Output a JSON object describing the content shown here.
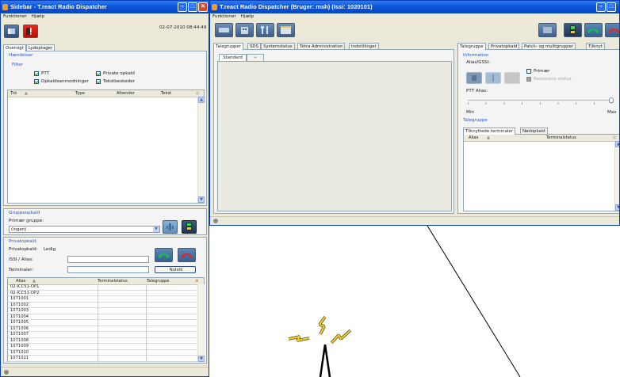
{
  "sidebar": {
    "title": "Sidebar - T.react Radio Dispatcher",
    "menu": [
      "Funktioner",
      "Hjælp"
    ],
    "datetime": "02-07-2010 08:44:49",
    "tabs": [
      "Oversigt",
      "Lydoptager"
    ],
    "events": {
      "section": "Hændelser",
      "filter_label": "Filter",
      "filters": [
        {
          "label": "PTT",
          "checked": true
        },
        {
          "label": "Private opkald",
          "checked": true
        },
        {
          "label": "Opkaldsanmodninger",
          "checked": true
        },
        {
          "label": "Tekstbeskeder",
          "checked": true
        }
      ],
      "columns": [
        "Tid",
        "Type",
        "Afsender",
        "Tekst"
      ]
    },
    "group_call": {
      "section": "Gruppeopkald",
      "primary_label": "Primær gruppe:",
      "primary_value": "(ingen)"
    },
    "private_call": {
      "section": "Privatopkald",
      "status_label": "Privatopkald:",
      "status_value": "Ledig",
      "issi_label": "ISSI / Alias:",
      "terminal_label": "Terminaler:",
      "reset_button": "Nulstil"
    },
    "terminal_table": {
      "columns": [
        "Alias",
        "Terminalstatus",
        "Talegruppe"
      ],
      "rows": [
        "02-ICC51-OP1",
        "02-ICC51-OP2",
        "1071001",
        "1071002",
        "1071003",
        "1071004",
        "1071005",
        "1071006",
        "1071007",
        "1071008",
        "1071009",
        "1071010",
        "1071011"
      ]
    }
  },
  "main": {
    "title": "T.react Radio Dispatcher (Bruger: msh) (Issi: 1020101)",
    "menu": [
      "Funktioner",
      "Hjælp"
    ],
    "tabs": [
      "Talegrupper",
      "SDS",
      "Systemstatus",
      "Tetra Administration",
      "Indstillinger"
    ],
    "subtabs": [
      "Standard",
      "+"
    ],
    "right_tabs": [
      "Talegruppe",
      "Privatopkald",
      "Patch- og multigrupper",
      "Tilknyt"
    ],
    "information": {
      "section": "Information",
      "alias_label": "Alias/GSSI:",
      "primary_label": "Primær",
      "resources_label": "Ressource status",
      "ptt_alias_label": "PTT Alias:",
      "min_label": "Min",
      "max_label": "Max"
    },
    "talkgroup": {
      "section": "Talegruppe",
      "tabs": [
        "Tilknyttede terminaler",
        "Nødopkald"
      ],
      "columns": [
        "Alias",
        "Terminalstatus"
      ]
    }
  },
  "colors": {
    "titlebar": "#0a55d8",
    "window_bg": "#ece9d8",
    "section_text": "#2858c8",
    "antenna_bolt": "#f6d21c"
  },
  "icons": [
    "window-logo-icon",
    "minimize-icon",
    "maximize-icon",
    "close-icon",
    "sidebar-toggle-icon",
    "alarm-icon",
    "tray-icon",
    "scroll-up-icon",
    "scroll-down-icon",
    "sort-icon",
    "group-call-icon",
    "accept-call-icon",
    "end-call-icon",
    "radio-tower-icon"
  ]
}
